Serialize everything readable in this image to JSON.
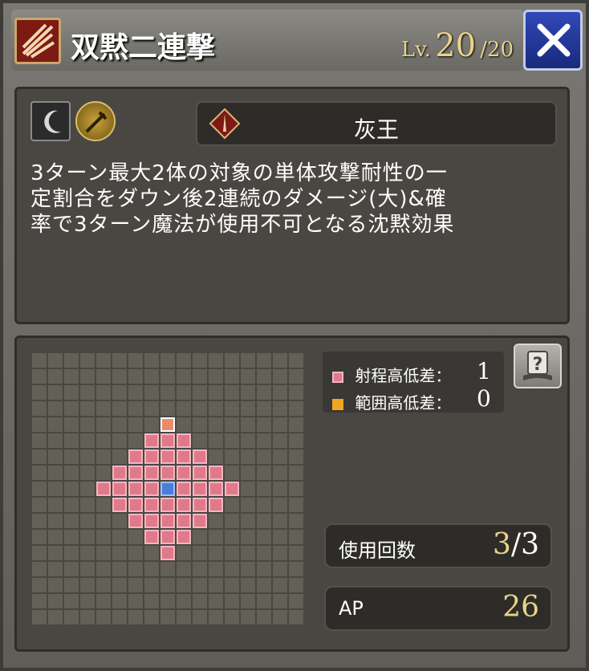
{
  "header": {
    "title": "双黙二連撃",
    "level_prefix": "Lv.",
    "level_current": "20",
    "level_max": "/20"
  },
  "skill": {
    "element_name": "灰王",
    "description_lines": [
      "3ターン最大2体の対象の単体攻撃耐性の一",
      "定割合をダウン後2連続のダメージ(大)&確",
      "率で3ターン魔法が使用不可となる沈黙効果"
    ]
  },
  "legend": {
    "range_label": "射程高低差：",
    "range_value": "1",
    "area_label": "範囲高低差：",
    "area_value": "0",
    "range_color": "#e07a8a",
    "area_color": "#f0a623"
  },
  "stats": {
    "uses_label": "使用回数",
    "uses_current": "3",
    "uses_sep": "/",
    "uses_max": "3",
    "ap_label": "AP",
    "ap_value": "26"
  },
  "icons": {
    "skill": "slash-icon",
    "close": "close-icon",
    "element1": "crescent-icon",
    "element2": "dagger-icon",
    "name_badge": "tower-icon",
    "help": "question-book-icon"
  },
  "grid": {
    "rows": 17,
    "cols": 17,
    "range_map": [
      ".................",
      ".................",
      ".................",
      ".................",
      "........t........",
      ".......rrr.......",
      "......rrrrr......",
      ".....rrrrrrr.....",
      "....rrrrcrrrr....",
      ".....rrrrrrr.....",
      "......rrrrr......",
      ".......rrr.......",
      "........r........",
      ".................",
      ".................",
      ".................",
      "................."
    ]
  }
}
